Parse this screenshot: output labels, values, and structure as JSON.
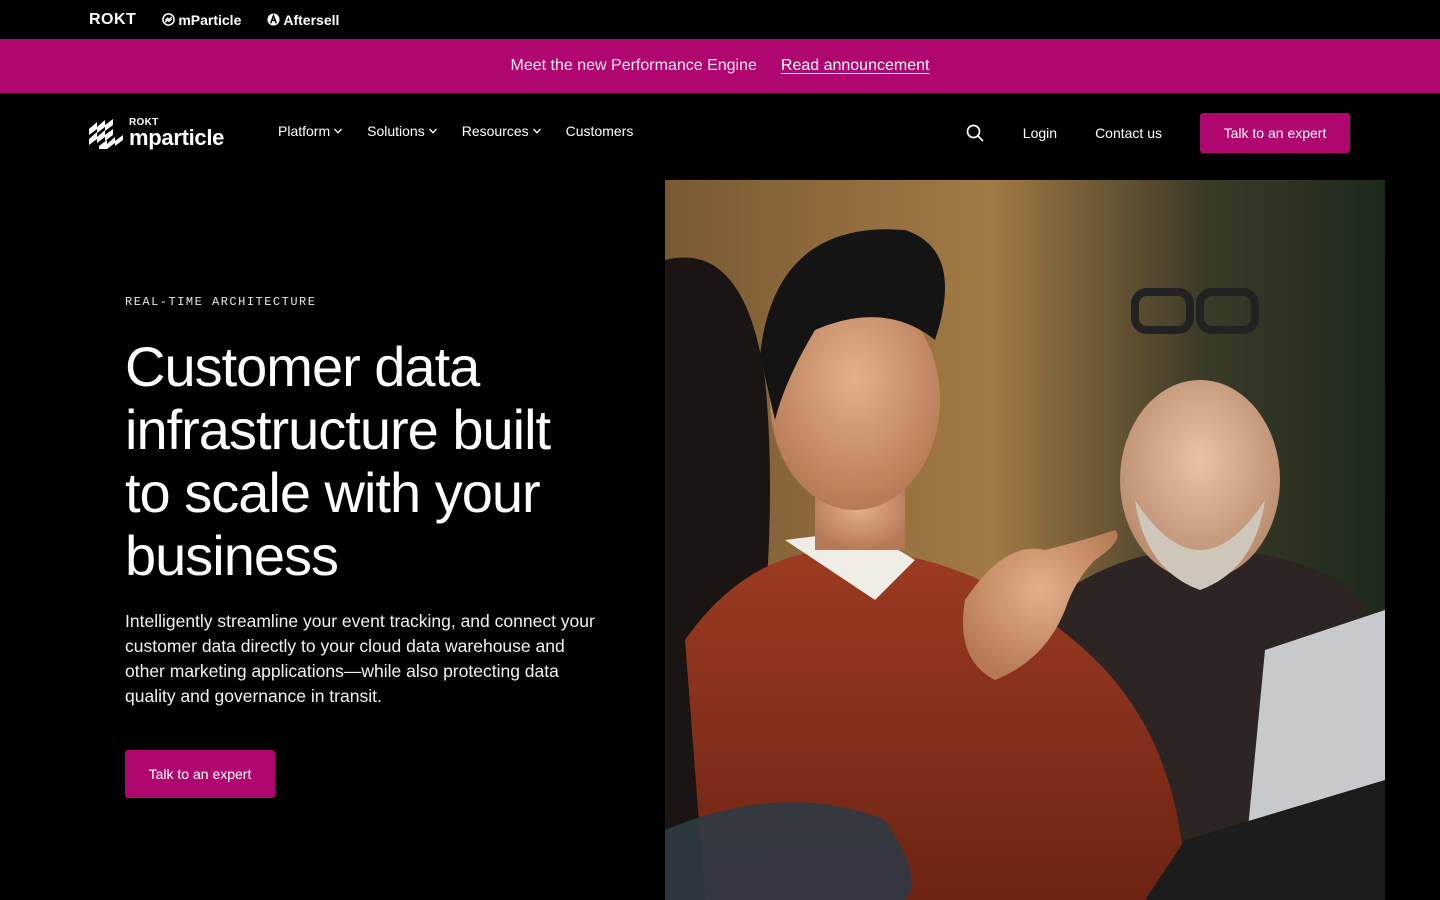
{
  "brand_strip": {
    "items": [
      {
        "label": "ROKT",
        "icon": "none"
      },
      {
        "label": "mParticle",
        "icon": "mparticle-icon"
      },
      {
        "label": "Aftersell",
        "icon": "aftersell-icon"
      }
    ]
  },
  "announcement": {
    "message": "Meet the new Performance Engine",
    "link_label": "Read announcement",
    "background": "#b0066f"
  },
  "nav": {
    "logo_small": "ROKT",
    "logo_big": "mparticle",
    "links": [
      {
        "label": "Platform",
        "has_dropdown": true
      },
      {
        "label": "Solutions",
        "has_dropdown": true
      },
      {
        "label": "Resources",
        "has_dropdown": true
      },
      {
        "label": "Customers",
        "has_dropdown": false
      }
    ],
    "login_label": "Login",
    "contact_label": "Contact us",
    "cta_label": "Talk to an expert",
    "accent": "#b0066f"
  },
  "hero": {
    "eyebrow": "REAL-TIME ARCHITECTURE",
    "title": "Customer data infrastructure built to scale with your business",
    "description": "Intelligently streamline your event tracking, and connect your customer data directly to your cloud data warehouse and other marketing applications—while also protecting data quality and governance in transit.",
    "cta_label": "Talk to an expert"
  }
}
